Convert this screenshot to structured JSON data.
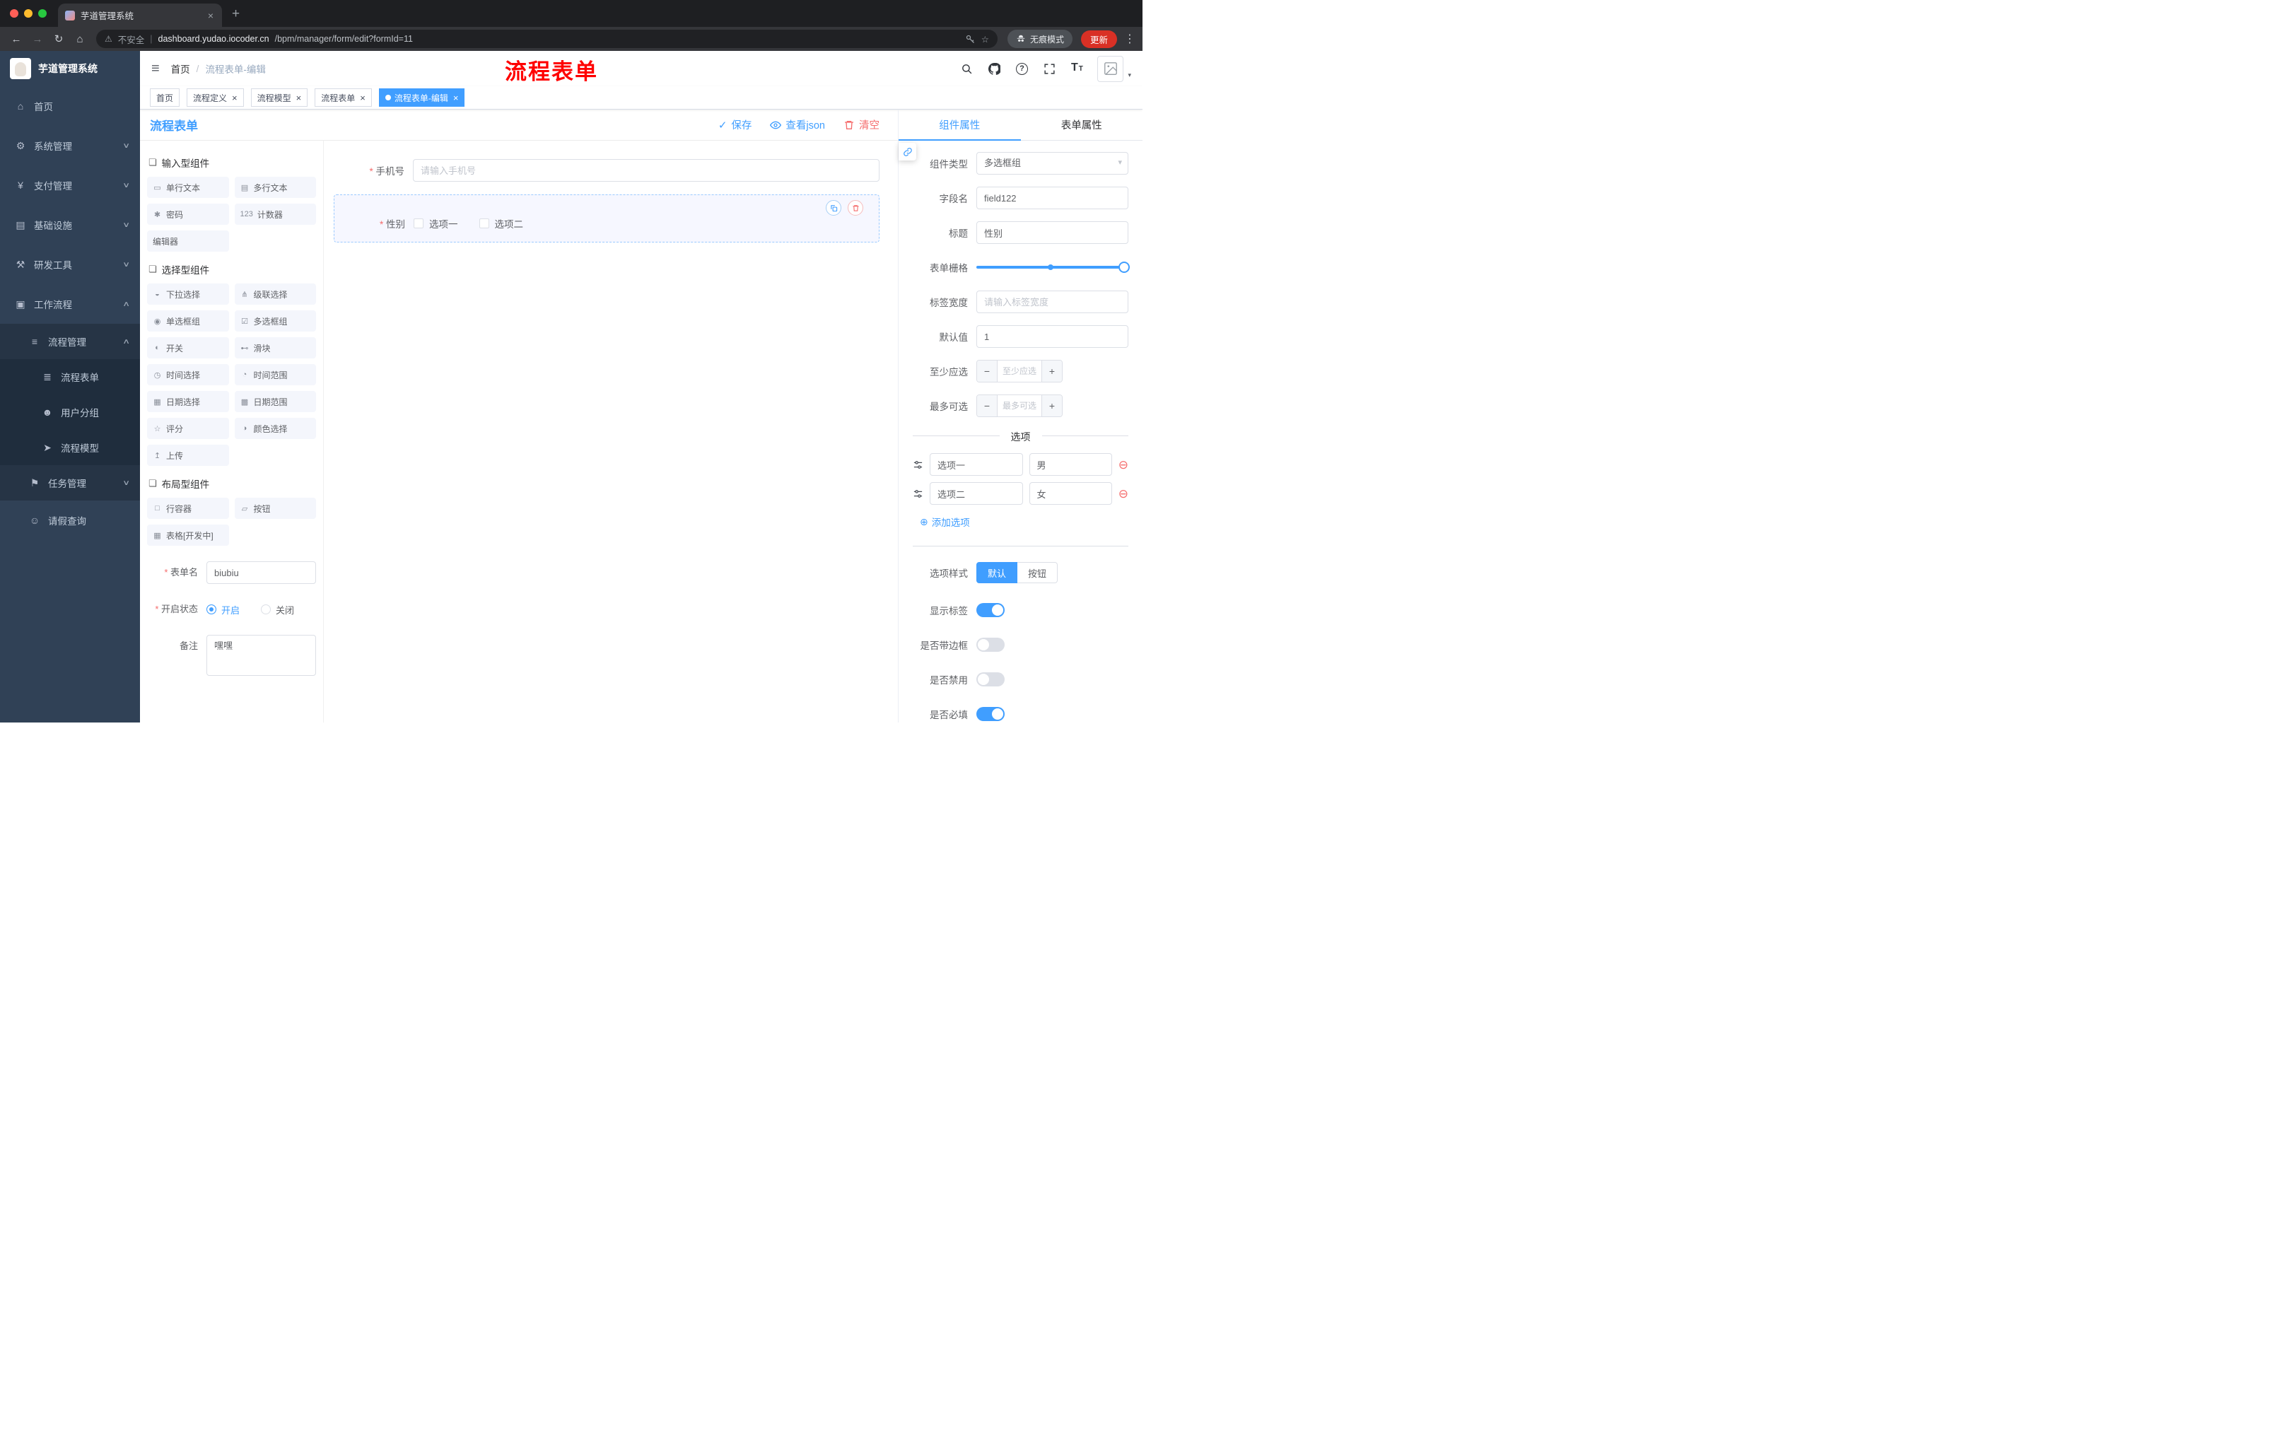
{
  "colors": {
    "accent": "#409eff",
    "danger": "#f56c6c",
    "annotation_red": "#ff0000",
    "sidebar_bg": "#304156",
    "active_tag_bg": "#409eff",
    "update_badge_bg": "#d93025"
  },
  "icons": {
    "back": "←",
    "forward": "→",
    "reload": "↻",
    "home": "⌂",
    "warning": "⚠",
    "pipe": "|",
    "star": "☆",
    "dots": "⋮",
    "new_tab": "+",
    "close": "×",
    "hamburger": "≡",
    "caret_down": "▾",
    "minus": "−",
    "plus": "+",
    "add_circle": "⊕",
    "remove_circle": "⊖",
    "check": "✓",
    "font_large": "T",
    "font_small": "T",
    "help": "?"
  },
  "browser": {
    "tab_title": "芋道管理系统",
    "security_label": "不安全",
    "url_host": "dashboard.yudao.iocoder.cn",
    "url_path": "/bpm/manager/form/edit?formId=11",
    "incognito_label": "无痕模式",
    "update_label": "更新"
  },
  "sidebar": {
    "app_title": "芋道管理系统",
    "items": [
      {
        "label": "首页",
        "glyph": "⌂",
        "chevron": ""
      },
      {
        "label": "系统管理",
        "glyph": "⚙",
        "chevron": "∨"
      },
      {
        "label": "支付管理",
        "glyph": "¥",
        "chevron": "∨"
      },
      {
        "label": "基础设施",
        "glyph": "▤",
        "chevron": "∨"
      },
      {
        "label": "研发工具",
        "glyph": "⚒",
        "chevron": "∨"
      },
      {
        "label": "工作流程",
        "glyph": "▣",
        "chevron": "∧"
      },
      {
        "label": "流程管理",
        "glyph": "≡",
        "chevron": "∧"
      },
      {
        "label": "流程表单",
        "glyph": "≣",
        "chevron": ""
      },
      {
        "label": "用户分组",
        "glyph": "☻",
        "chevron": ""
      },
      {
        "label": "流程模型",
        "glyph": "➤",
        "chevron": ""
      },
      {
        "label": "任务管理",
        "glyph": "⚑",
        "chevron": "∨"
      },
      {
        "label": "请假查询",
        "glyph": "☺",
        "chevron": ""
      }
    ]
  },
  "header": {
    "breadcrumb": [
      "首页",
      "流程表单-编辑"
    ],
    "separator": "/",
    "annotation": "流程表单"
  },
  "tagbar": {
    "tags": [
      {
        "label": "首页",
        "affix": true
      },
      {
        "label": "流程定义",
        "closable": true
      },
      {
        "label": "流程模型",
        "closable": true
      },
      {
        "label": "流程表单",
        "closable": true
      },
      {
        "label": "流程表单-编辑",
        "closable": true,
        "active": true
      }
    ]
  },
  "toolbar": {
    "title": "流程表单",
    "save_label": "保存",
    "view_json_label": "查看json",
    "clear_label": "清空"
  },
  "palette": {
    "section_icon": "❏",
    "sections": [
      {
        "title": "输入型组件",
        "items": [
          {
            "glyph": "▭",
            "label": "单行文本"
          },
          {
            "glyph": "▤",
            "label": "多行文本"
          },
          {
            "glyph": "✱",
            "label": "密码"
          },
          {
            "glyph": "123",
            "label": "计数器"
          },
          {
            "glyph": "",
            "label": "编辑器"
          }
        ]
      },
      {
        "title": "选择型组件",
        "items": [
          {
            "glyph": "◒",
            "label": "下拉选择"
          },
          {
            "glyph": "⋔",
            "label": "级联选择"
          },
          {
            "glyph": "◉",
            "label": "单选框组"
          },
          {
            "glyph": "☑",
            "label": "多选框组"
          },
          {
            "glyph": "◐",
            "label": "开关"
          },
          {
            "glyph": "⊷",
            "label": "滑块"
          },
          {
            "glyph": "◷",
            "label": "时间选择"
          },
          {
            "glyph": "◔",
            "label": "时间范围"
          },
          {
            "glyph": "▦",
            "label": "日期选择"
          },
          {
            "glyph": "▩",
            "label": "日期范围"
          },
          {
            "glyph": "☆",
            "label": "评分"
          },
          {
            "glyph": "◑",
            "label": "颜色选择"
          },
          {
            "glyph": "↥",
            "label": "上传"
          }
        ]
      },
      {
        "title": "布局型组件",
        "items": [
          {
            "glyph": "□",
            "label": "行容器"
          },
          {
            "glyph": "▱",
            "label": "按钮"
          },
          {
            "glyph": "▦",
            "label": "表格[开发中]"
          }
        ]
      }
    ],
    "form": {
      "name_label": "表单名",
      "name_value": "biubiu",
      "status_label": "开启状态",
      "status_on": "开启",
      "status_off": "关闭",
      "remark_label": "备注",
      "remark_value": "嘿嘿"
    }
  },
  "canvas": {
    "phone": {
      "label": "手机号",
      "placeholder": "请输入手机号"
    },
    "gender": {
      "label": "性别",
      "options": [
        "选项一",
        "选项二"
      ]
    }
  },
  "inspector": {
    "tab_component": "组件属性",
    "tab_form": "表单属性",
    "component_type_label": "组件类型",
    "component_type_value": "多选框组",
    "field_name_label": "字段名",
    "field_name_value": "field122",
    "title_label": "标题",
    "title_value": "性别",
    "grid_label": "表单栅格",
    "label_width_label": "标签宽度",
    "label_width_placeholder": "请输入标签宽度",
    "default_label": "默认值",
    "default_value": "1",
    "min_label": "至少应选",
    "min_placeholder": "至少应选",
    "max_label": "最多可选",
    "max_placeholder": "最多可选",
    "options_title": "选项",
    "options": [
      {
        "name": "选项一",
        "value": "男"
      },
      {
        "name": "选项二",
        "value": "女"
      }
    ],
    "add_option_label": "添加选项",
    "style_label": "选项样式",
    "style_options": [
      {
        "label": "默认",
        "active": true
      },
      {
        "label": "按钮",
        "active": false
      }
    ],
    "switches": [
      {
        "label": "显示标签",
        "on": true
      },
      {
        "label": "是否带边框",
        "on": false
      },
      {
        "label": "是否禁用",
        "on": false
      },
      {
        "label": "是否必填",
        "on": true
      }
    ]
  }
}
